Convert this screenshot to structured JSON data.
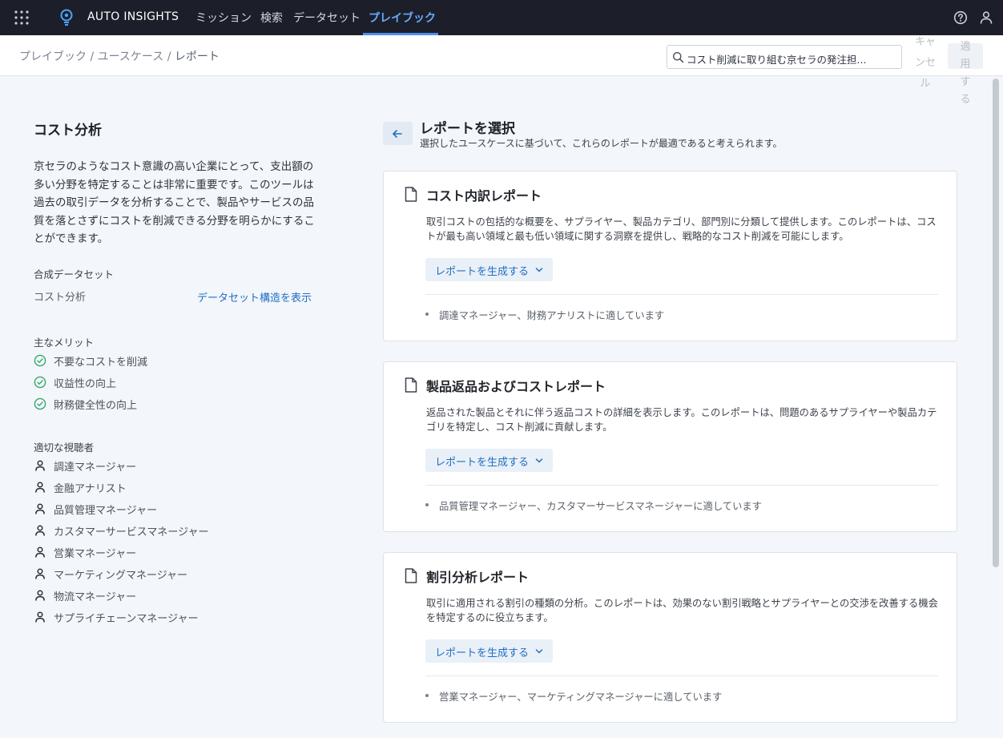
{
  "nav": {
    "brand": "AUTO INSIGHTS",
    "items": [
      {
        "label": "ミッション"
      },
      {
        "label": "検索"
      },
      {
        "label": "データセット"
      },
      {
        "label": "プレイブック",
        "active": true
      }
    ],
    "accent": "#6aa9ff"
  },
  "header": {
    "breadcrumb": [
      "プレイブック",
      "ユースケース",
      "レポート"
    ],
    "search_value": "コスト削減に取り組む京セラの発注担...",
    "cancel_label": "キャンセル",
    "apply_label": "適用する"
  },
  "left": {
    "title": "コスト分析",
    "description": "京セラのようなコスト意識の高い企業にとって、支出額の多い分野を特定することは非常に重要です。このツールは過去の取引データを分析することで、製品やサービスの品質を落とさずにコストを削減できる分野を明らかにすることができます。",
    "dataset_label": "合成データセット",
    "dataset_name": "コスト分析",
    "dataset_link": "データセット構造を表示",
    "benefits_label": "主なメリット",
    "benefits": [
      "不要なコストを削減",
      "収益性の向上",
      "財務健全性の向上"
    ],
    "audience_label": "適切な視聴者",
    "audience": [
      "調達マネージャー",
      "金融アナリスト",
      "品質管理マネージャー",
      "カスタマーサービスマネージャー",
      "営業マネージャー",
      "マーケティングマネージャー",
      "物流マネージャー",
      "サプライチェーンマネージャー"
    ]
  },
  "main": {
    "title": "レポートを選択",
    "subtitle": "選択したユースケースに基づいて、これらのレポートが最適であると考えられます。",
    "reports": [
      {
        "title": "コスト内訳レポート",
        "description": "取引コストの包括的な概要を、サプライヤー、製品カテゴリ、部門別に分類して提供します。このレポートは、コストが最も高い領域と最も低い領域に関する洞察を提供し、戦略的なコスト削減を可能にします。",
        "button": "レポートを生成する",
        "suitable": "調達マネージャー、財務アナリストに適しています"
      },
      {
        "title": "製品返品およびコストレポート",
        "description": "返品された製品とそれに伴う返品コストの詳細を表示します。このレポートは、問題のあるサプライヤーや製品カテゴリを特定し、コスト削減に貢献します。",
        "button": "レポートを生成する",
        "suitable": "品質管理マネージャー、カスタマーサービスマネージャーに適しています"
      },
      {
        "title": "割引分析レポート",
        "description": "取引に適用される割引の種類の分析。このレポートは、効果のない割引戦略とサプライヤーとの交渉を改善する機会を特定するのに役立ちます。",
        "button": "レポートを生成する",
        "suitable": "営業マネージャー、マーケティングマネージャーに適しています"
      }
    ]
  }
}
